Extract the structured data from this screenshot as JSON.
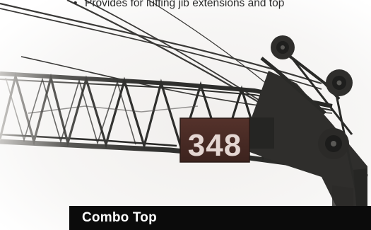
{
  "bullets": {
    "bullet_symbol": "•",
    "item_text": "Provides for luffing jib extensions and top"
  },
  "photo": {
    "boom_number": "348"
  },
  "section": {
    "title": "Combo Top"
  },
  "colors": {
    "lattice": "#2d2d2b",
    "sky": "#f5f4f2",
    "number_plate": "#4a2c26",
    "number_text": "#e4d6d2",
    "heading_bar": "#0b0b0b",
    "heading_text": "#ffffff"
  }
}
